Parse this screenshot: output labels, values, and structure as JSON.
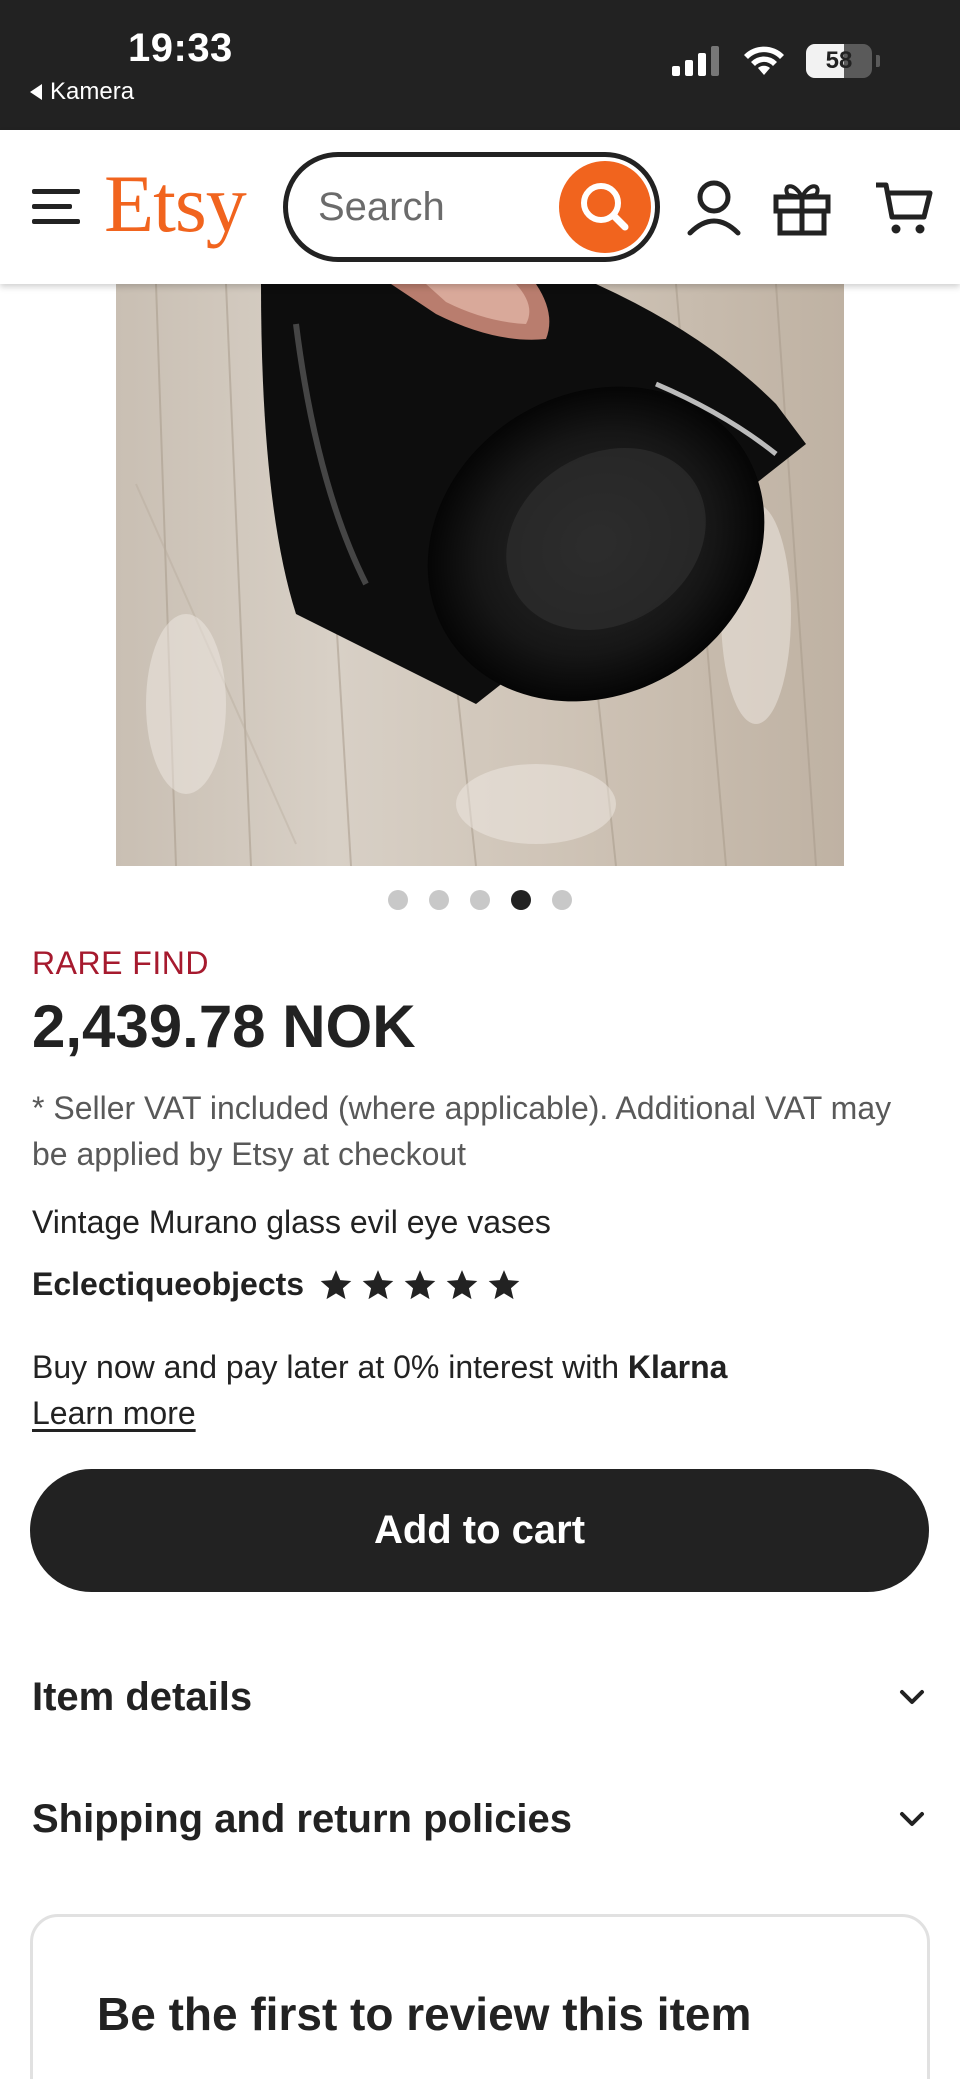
{
  "status_bar": {
    "time": "19:33",
    "back_label": "Kamera",
    "battery_level": "58",
    "battery_fraction": 0.58
  },
  "header": {
    "logo": "Etsy",
    "search_placeholder": "Search",
    "icons": [
      "menu-icon",
      "search-icon",
      "account-icon",
      "gift-icon",
      "cart-icon"
    ],
    "brand_color": "#F1641E"
  },
  "gallery": {
    "image_description": "black Murano glass vase lying on weathered wooden surface",
    "dot_count": 5,
    "active_index": 3
  },
  "product": {
    "badge": "RARE FIND",
    "badge_color": "#A61A2E",
    "price": "2,439.78 NOK",
    "vat_note": "* Seller VAT included (where applicable). Additional VAT may be applied by Etsy at checkout",
    "title": "Vintage Murano glass evil eye vases",
    "seller": "Eclectiqueobjects",
    "rating_stars": 5
  },
  "klarna": {
    "text": "Buy now and pay later at 0% interest with",
    "brand": "Klarna",
    "learn_more": "Learn more"
  },
  "actions": {
    "add_to_cart": "Add to cart"
  },
  "sections": [
    {
      "label": "Item details"
    },
    {
      "label": "Shipping and return policies"
    }
  ],
  "reviews": {
    "empty_label": "Be the first to review this item"
  }
}
